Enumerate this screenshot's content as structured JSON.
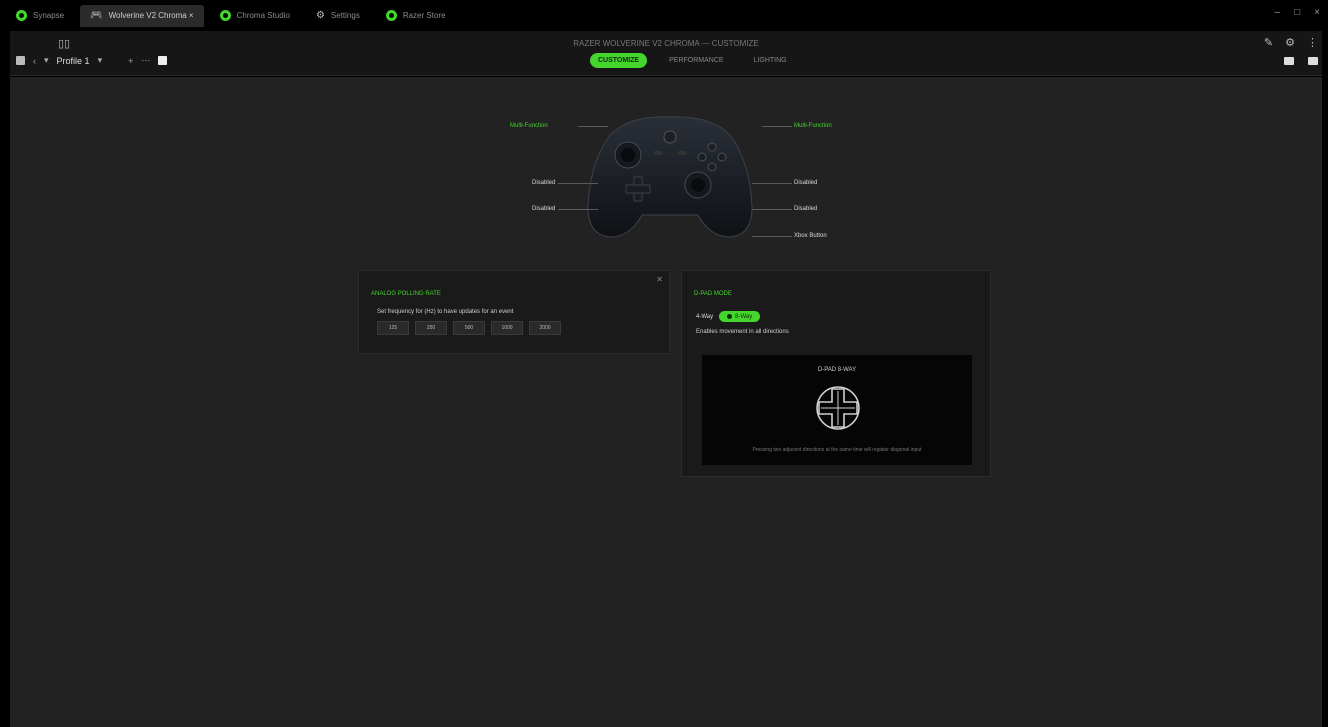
{
  "tabs": [
    {
      "label": "Synapse",
      "icon": "razer-logo-icon",
      "active": false
    },
    {
      "label": "Wolverine V2 Chroma ×",
      "icon": "controller-icon",
      "active": true
    },
    {
      "label": "Chroma Studio",
      "icon": "razer-logo-icon",
      "active": false
    },
    {
      "label": "Settings",
      "icon": "gear-icon",
      "active": false
    },
    {
      "label": "Razer Store",
      "icon": "razer-logo-icon",
      "active": false
    }
  ],
  "window_controls": [
    "–",
    "□",
    "×"
  ],
  "header": {
    "center_title": "RAZER WOLVERINE V2 CHROMA — CUSTOMIZE",
    "profile_selector": "Profile 1",
    "segments": [
      "CUSTOMIZE",
      "PERFORMANCE",
      "LIGHTING"
    ],
    "active_segment": 0
  },
  "controller": {
    "left_labels": [
      "Multi-Function",
      "Disabled",
      "Disabled"
    ],
    "right_labels": [
      "Multi-Function",
      "Disabled",
      "Disabled",
      "Xbox Button"
    ]
  },
  "polling_panel": {
    "title": "ANALOG POLLING RATE",
    "text": "Set frequency for (Hz) to have updates for an event",
    "rates": [
      "125",
      "250",
      "500",
      "1000",
      "2000"
    ]
  },
  "dpad_panel": {
    "title": "D-PAD MODE",
    "mode_label": "4-Way",
    "mode_active": "8-Way",
    "description": "Enables movement in all directions",
    "diagram_title": "D-PAD 8-WAY",
    "diagram_note": "Pressing two adjacent directions at the same time will register diagonal input"
  },
  "colors": {
    "accent": "#44d62c",
    "background": "#222222",
    "panel": "#1a1a1a"
  }
}
